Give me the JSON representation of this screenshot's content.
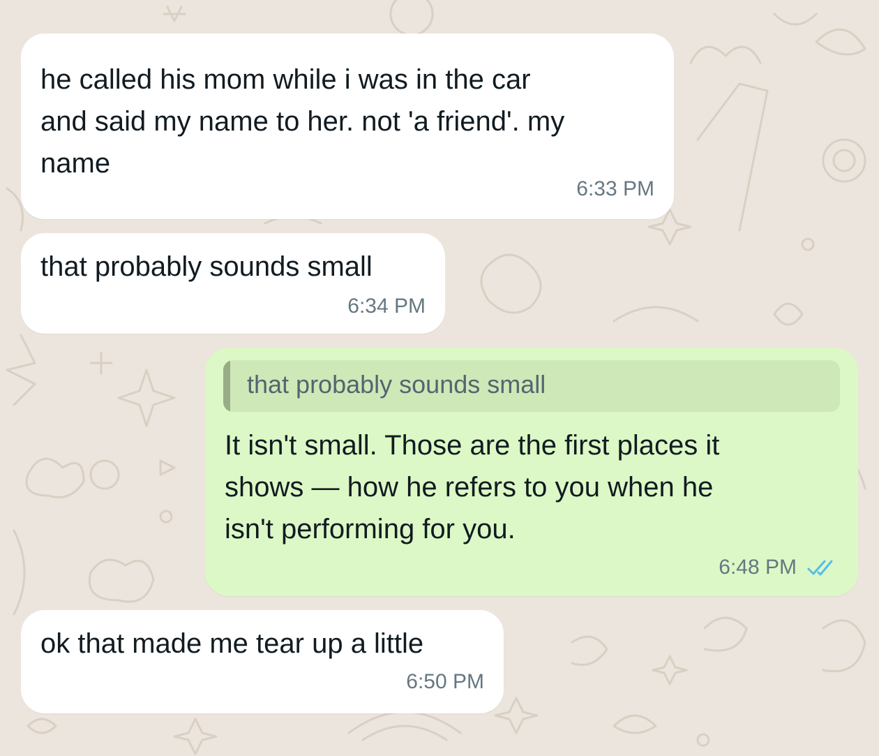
{
  "messages": [
    {
      "direction": "incoming",
      "text": "he called his mom while i was in the car\nand said my name to her. not 'a friend'. my\nname",
      "time": "6:33 PM"
    },
    {
      "direction": "incoming",
      "text": "that probably sounds small",
      "time": "6:34 PM"
    },
    {
      "direction": "outgoing",
      "quoted_text": "that probably sounds small",
      "text": "It isn't small. Those are the first places it\nshows — how he refers to you when he\nisn't performing for you.",
      "time": "6:48 PM",
      "status_icon": "double-check-read-icon"
    },
    {
      "direction": "incoming",
      "text": "ok that made me tear up a little",
      "time": "6:50 PM"
    }
  ],
  "colors": {
    "wallpaper": "#ECE5DD",
    "doodle_stroke": "#D9CFC3",
    "incoming_bubble": "#FFFFFF",
    "outgoing_bubble": "#DCF8C6",
    "quote_background": "#CFE8B8",
    "quote_bar": "#98AD86",
    "timestamp": "#667781",
    "read_ticks": "#53BDEB"
  }
}
